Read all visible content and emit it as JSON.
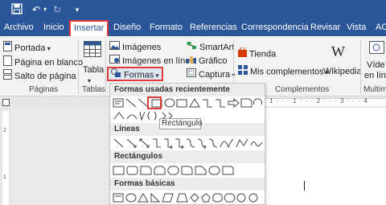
{
  "colors": {
    "titlebar": "#2b579a",
    "ribbon": "#f3f3f3",
    "highlight": "#e23b3b",
    "accent_text": "#2b579a"
  },
  "quick_access": {
    "icons": [
      "save-icon",
      "undo-icon",
      "redo-icon",
      "customize-icon"
    ]
  },
  "tabs": [
    {
      "label": "Archivo"
    },
    {
      "label": "Inicio"
    },
    {
      "label": "Insertar",
      "active": true
    },
    {
      "label": "Diseño"
    },
    {
      "label": "Formato"
    },
    {
      "label": "Referencias"
    },
    {
      "label": "Correspondencia"
    },
    {
      "label": "Revisar"
    },
    {
      "label": "Vista"
    },
    {
      "label": "AC"
    }
  ],
  "ribbon": {
    "paginas": {
      "portada": "Portada",
      "pagina_en_blanco": "Página en blanco",
      "salto_de_pagina": "Salto de página",
      "group_label": "Páginas"
    },
    "tablas": {
      "tabla": "Tabla",
      "group_label": "Tablas"
    },
    "ilustraciones": {
      "imagenes": "Imágenes",
      "imagenes_en_linea": "Imágenes en línea",
      "formas": "Formas",
      "smartart": "SmartArt",
      "grafico": "Gráfico",
      "captura": "Captura"
    },
    "complementos": {
      "tienda": "Tienda",
      "mis_complementos": "Mis complementos",
      "wikipedia": "Wikipedia",
      "group_label": "Complementos"
    },
    "multimedia": {
      "video_line1": "Víde",
      "video_line2": "en lín",
      "group_label": "Multime"
    }
  },
  "shapes_dropdown": {
    "recent_header": "Formas usadas recientemente",
    "lineas_header": "Líneas",
    "rectangulos_header": "Rectángulos",
    "basicas_header": "Formas básicas",
    "tooltip": "Rectángulo"
  },
  "ruler": {
    "numbers": "1 · · · 1 · · · 2 · · · 3 · · · 4"
  },
  "vruler": {
    "numbers": [
      "2",
      "1"
    ]
  }
}
